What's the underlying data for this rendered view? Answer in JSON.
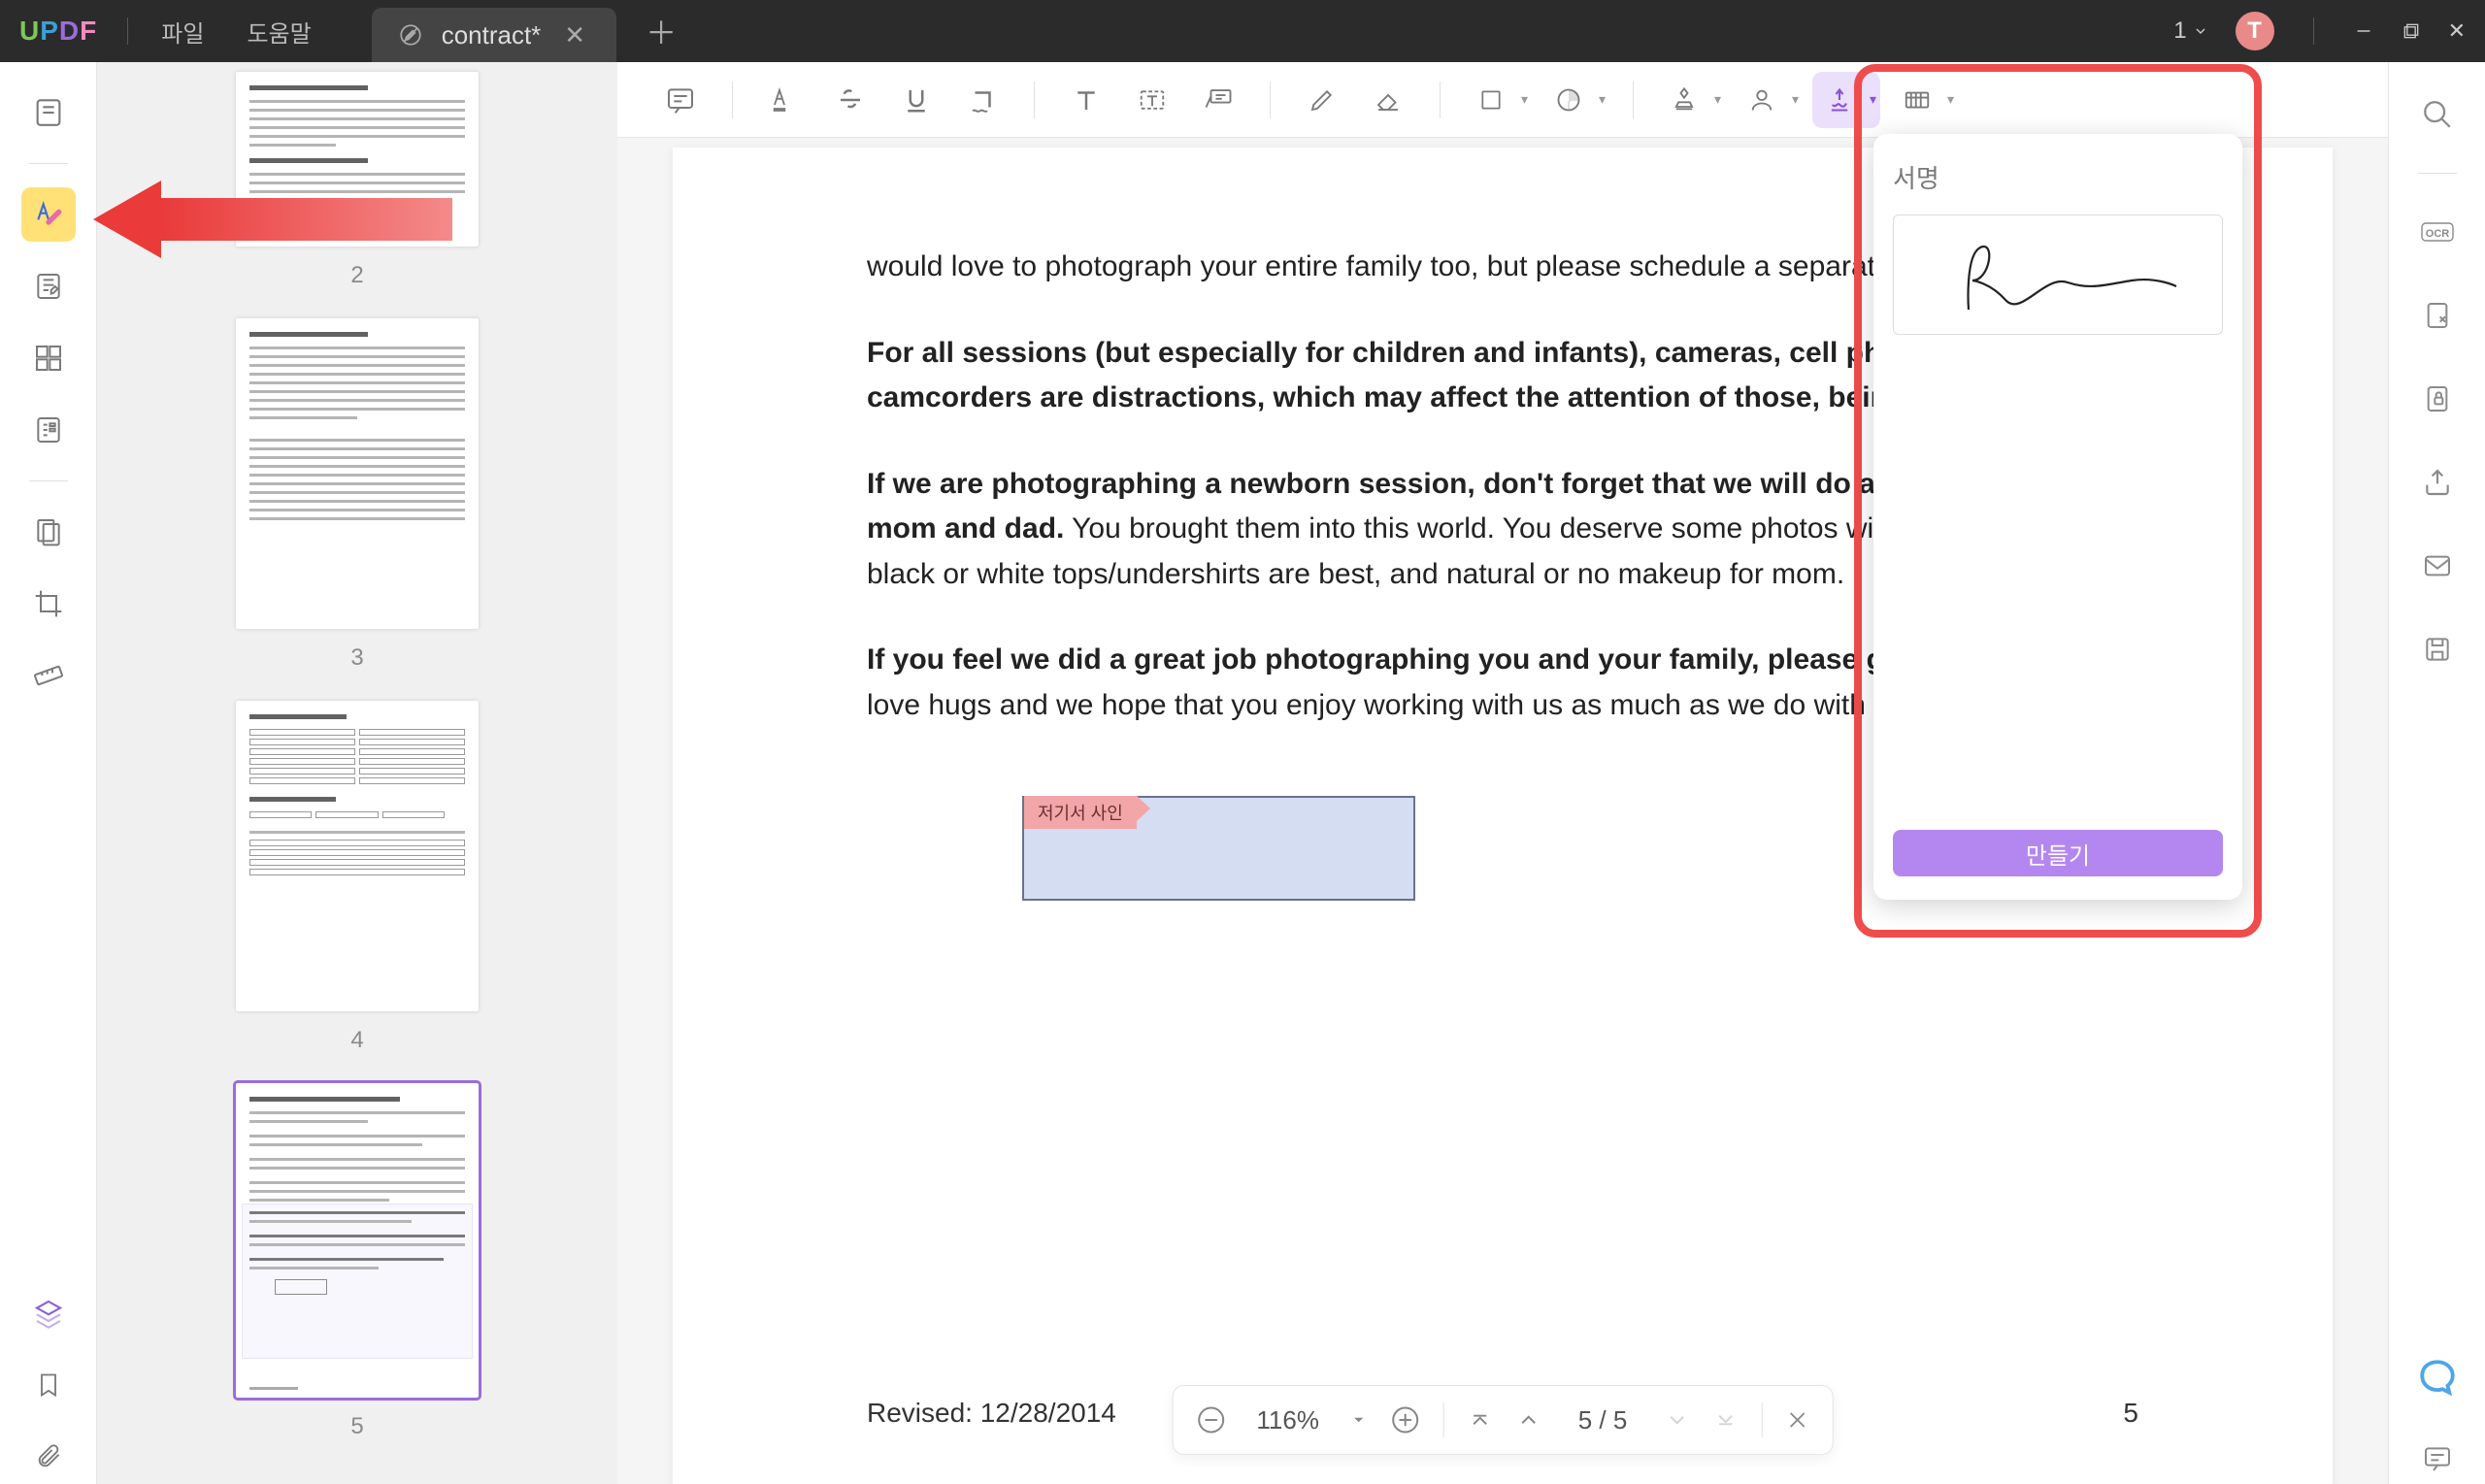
{
  "titlebar": {
    "menu_file": "파일",
    "menu_help": "도움말",
    "tab_title": "contract*",
    "count": "1",
    "avatar_initial": "T"
  },
  "thumbnails": [
    {
      "num": "2"
    },
    {
      "num": "3"
    },
    {
      "num": "4"
    },
    {
      "num": "5"
    }
  ],
  "doc": {
    "p1": "would love to photograph your entire family too, but please schedule a separate session with us.",
    "p2b": "For all sessions (but especially for children and infants), cameras, cell phones, and camcorders are distractions, which may affect the attention of those, being photographed.",
    "p3b": "If we are photographing a newborn session, don't forget that we will do a few shots with mom and dad.",
    "p3": " You brought them into this world. You deserve some photos with them. Simple black or white tops/undershirts are best, and natural or no makeup for mom.",
    "p4b": "If you feel we did a great job photographing you and your family, please give us a ring.",
    "p4": " We love hugs and we hope that you enjoy working with us as much as we do with you.",
    "sign_tag": "저기서 사인",
    "revised": "Revised: 12/28/2014",
    "pagenum": "5"
  },
  "signature_panel": {
    "title": "서명",
    "create": "만들기"
  },
  "footer": {
    "zoom": "116%",
    "page_indicator": "5 / 5"
  }
}
